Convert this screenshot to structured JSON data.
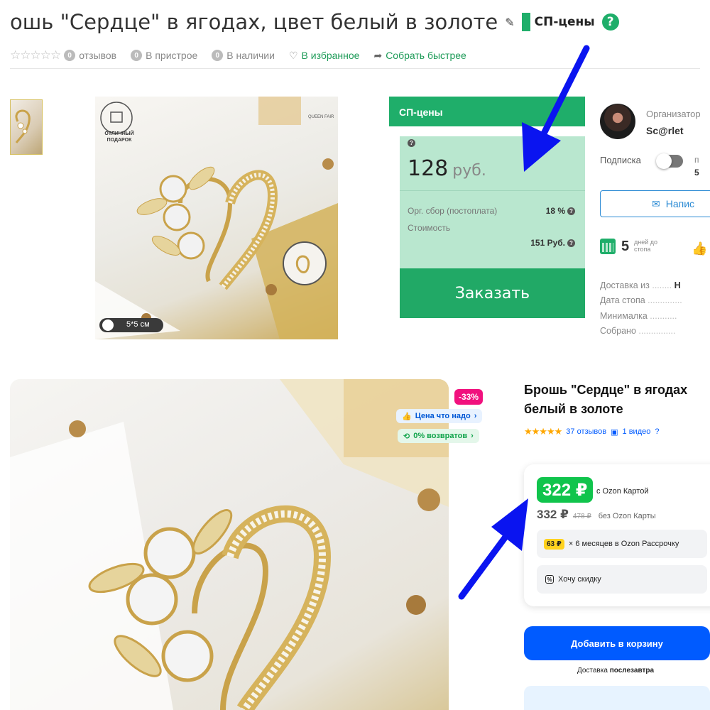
{
  "sp": {
    "title": "ошь \"Сердце\" в ягодах, цвет белый в золоте",
    "badge": "СП-цены",
    "help": "?",
    "stars": "☆☆☆☆☆",
    "reviews_count": "0",
    "reviews_label": "отзывов",
    "in_process_count": "0",
    "in_process_label": "В пристрое",
    "in_stock_count": "0",
    "in_stock_label": "В наличии",
    "favorite_label": "В избранное",
    "collect_label": "Собрать быстрее",
    "image_gift_text": "ОТЛИЧНЫЙ ПОДАРОК",
    "image_brand_text": "QUEEN FAIR",
    "image_size_text": "5*5 см",
    "price_box": {
      "header": "СП-цены",
      "price": "128",
      "currency": "руб.",
      "org_fee_label": "Орг. сбор (постоплата)",
      "org_fee_value": "18 %",
      "cost_label": "Стоимость",
      "cost_value": "151 Руб.",
      "order_button": "Заказать"
    },
    "organizer": {
      "label": "Организатор",
      "name": "Sc@rlet",
      "subscription_label": "Подписка",
      "subscription_right_top": "п",
      "subscription_right_value": "5",
      "write_button": "Напис",
      "days_value": "5",
      "days_label": "дней до стопа",
      "info": [
        {
          "label": "Доставка из",
          "value": "Н"
        },
        {
          "label": "Дата стопа",
          "value": ""
        },
        {
          "label": "Минималка",
          "value": ""
        },
        {
          "label": "Собрано",
          "value": ""
        }
      ]
    }
  },
  "ozon": {
    "discount_badge": "-33%",
    "price_good_label": "Цена что надо",
    "returns_label": "0% возвратов",
    "title": "Брошь \"Сердце\" в ягодах белый в золоте",
    "rating_stars": "★★★★★",
    "reviews": "37 отзывов",
    "video": "1 видео",
    "card_price": "322 ₽",
    "card_price_label": "с Ozon Картой",
    "regular_price": "332 ₽",
    "old_price": "478 ₽",
    "regular_label": "без Ozon Карты",
    "installment_amount": "63 ₽",
    "installment_text": "× 6 месяцев в Ozon Рассрочку",
    "want_discount": "Хочу скидку",
    "add_to_cart": "Добавить в корзину",
    "delivery_prefix": "Доставка",
    "delivery_day": "послезавтра"
  },
  "colors": {
    "sp_green": "#1fae6a",
    "ozon_blue": "#005bff",
    "ozon_green": "#10c44c",
    "discount_pink": "#f1117e",
    "annotation_arrow": "#0a14f0"
  }
}
